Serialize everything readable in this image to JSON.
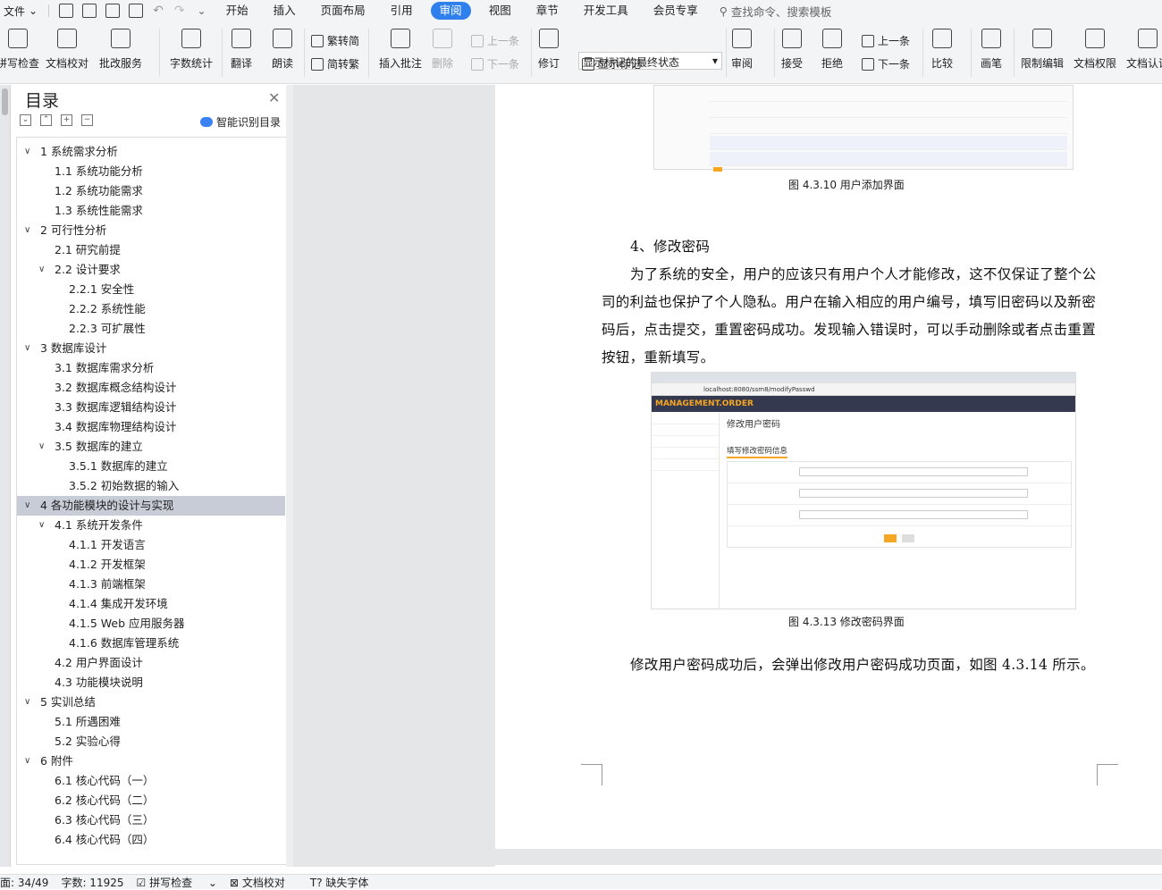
{
  "menubar": {
    "file": "文件",
    "tabs": [
      "开始",
      "插入",
      "页面布局",
      "引用",
      "审阅",
      "视图",
      "章节",
      "开发工具",
      "会员专享"
    ],
    "active_tab": "审阅",
    "search": "查找命令、搜索模板"
  },
  "ribbon": {
    "spell": "拼写检查",
    "doc_check": "文档校对",
    "batch": "批改服务",
    "word_count": "字数统计",
    "translate": "翻译",
    "read": "朗读",
    "fan2jian": "繁转简",
    "jian2fan": "简转繁",
    "insert_comment": "插入批注",
    "delete": "删除",
    "prev_comment": "上一条",
    "next_comment": "下一条",
    "revise": "修订",
    "markup_state": "显示标记的最终状态",
    "show_markup": "显示标记",
    "review": "审阅",
    "accept": "接受",
    "reject": "拒绝",
    "prev": "上一条",
    "next": "下一条",
    "compare": "比较",
    "pen": "画笔",
    "restrict": "限制编辑",
    "permission": "文档权限",
    "cert": "文档认证"
  },
  "toc": {
    "title": "目录",
    "smart": "智能识别目录",
    "items": [
      {
        "label": "1  系统需求分析",
        "level": 1,
        "caret": true
      },
      {
        "label": "1.1  系统功能分析",
        "level": 2
      },
      {
        "label": "1.2  系统功能需求",
        "level": 2
      },
      {
        "label": "1.3  系统性能需求",
        "level": 2
      },
      {
        "label": "2  可行性分析",
        "level": 1,
        "caret": true
      },
      {
        "label": "2.1  研究前提",
        "level": 2
      },
      {
        "label": "2.2  设计要求",
        "level": 2,
        "caret": true
      },
      {
        "label": "2.2.1  安全性",
        "level": 3
      },
      {
        "label": "2.2.2  系统性能",
        "level": 3
      },
      {
        "label": "2.2.3  可扩展性",
        "level": 3
      },
      {
        "label": "3  数据库设计",
        "level": 1,
        "caret": true
      },
      {
        "label": "3.1  数据库需求分析",
        "level": 2
      },
      {
        "label": "3.2  数据库概念结构设计",
        "level": 2
      },
      {
        "label": "3.3  数据库逻辑结构设计",
        "level": 2
      },
      {
        "label": "3.4  数据库物理结构设计",
        "level": 2
      },
      {
        "label": "3.5  数据库的建立",
        "level": 2,
        "caret": true
      },
      {
        "label": "3.5.1  数据库的建立",
        "level": 3
      },
      {
        "label": "3.5.2  初始数据的输入",
        "level": 3
      },
      {
        "label": "4  各功能模块的设计与实现",
        "level": 1,
        "caret": true,
        "selected": true
      },
      {
        "label": "4.1  系统开发条件",
        "level": 2,
        "caret": true
      },
      {
        "label": "4.1.1  开发语言",
        "level": 3
      },
      {
        "label": "4.1.2  开发框架",
        "level": 3
      },
      {
        "label": "4.1.3  前端框架",
        "level": 3
      },
      {
        "label": "4.1.4  集成开发环境",
        "level": 3
      },
      {
        "label": "4.1.5 Web 应用服务器",
        "level": 3
      },
      {
        "label": "4.1.6  数据库管理系统",
        "level": 3
      },
      {
        "label": "4.2  用户界面设计",
        "level": 2
      },
      {
        "label": "4.3  功能模块说明",
        "level": 2
      },
      {
        "label": "5  实训总结",
        "level": 1,
        "caret": true
      },
      {
        "label": "5.1  所遇困难",
        "level": 2
      },
      {
        "label": "5.2  实验心得",
        "level": 2
      },
      {
        "label": "6  附件",
        "level": 1,
        "caret": true
      },
      {
        "label": "6.1  核心代码（一）",
        "level": 2
      },
      {
        "label": "6.2  核心代码（二）",
        "level": 2
      },
      {
        "label": "6.3  核心代码（三）",
        "level": 2
      },
      {
        "label": "6.4  核心代码（四）",
        "level": 2
      }
    ]
  },
  "doc": {
    "cap1": "图 4.3.10  用户添加界面",
    "heading": "4、修改密码",
    "para": [
      "为了系统的安全，用户的应该只有用户个人才能修改，这不仅保证了整个公",
      "司的利益也保护了个人隐私。用户在输入相应的用户编号，填写旧密码以及新密",
      "码后，点击提交，重置密码成功。发现输入错误时，可以手动删除或者点击重置",
      "按钮，重新填写。"
    ],
    "shot": {
      "url": "localhost:8080/ssm8/modifyPasswd",
      "brand": "MANAGEMENT.ORDER",
      "title": "修改用户密码",
      "subtitle": "填写修改密码信息"
    },
    "cap2": "图 4.3.13  修改密码界面",
    "para2": "修改用户密码成功后，会弹出修改用户密码成功页面，如图 4.3.14 所示。"
  },
  "status": {
    "page": "面: 34/49",
    "words": "字数: 11925",
    "spell": "拼写检查",
    "proof": "文档校对",
    "font": "缺失字体"
  }
}
